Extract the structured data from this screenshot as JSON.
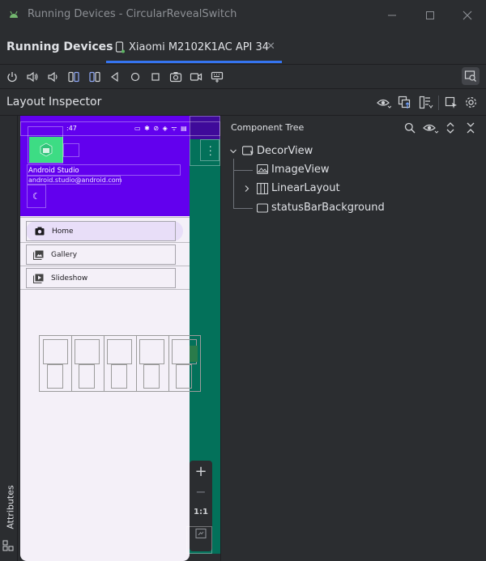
{
  "window": {
    "title": "Running Devices - CircularRevealSwitch",
    "app_icon": "android-icon",
    "controls": [
      "minimize",
      "maximize",
      "close"
    ]
  },
  "tool_window": {
    "title": "Running Devices",
    "device_tab": {
      "label": "Xiaomi M2102K1AC API 34",
      "icon": "phone-icon"
    }
  },
  "toolbar": {
    "icons": [
      "power-icon",
      "volume-up-icon",
      "volume-down-icon",
      "rotate-left-icon",
      "rotate-right-icon",
      "back-icon",
      "home-icon",
      "overview-icon",
      "screenshot-icon",
      "screen-record-icon",
      "settings-device-icon",
      "layout-inspector-toggle-icon"
    ]
  },
  "layout_inspector": {
    "title": "Layout Inspector",
    "header_icons": [
      "eye-icon",
      "snapshot-icon",
      "live-update-icon",
      "select-icon",
      "gear-icon"
    ]
  },
  "side_panel": {
    "label": "Attributes"
  },
  "device_screen": {
    "status_time": ":47",
    "user_name": "Android Studio",
    "user_email": "android.studio@android.com",
    "menu": [
      {
        "label": "Home",
        "icon": "camera-icon",
        "selected": true
      },
      {
        "label": "Gallery",
        "icon": "gallery-icon",
        "selected": false
      },
      {
        "label": "Slideshow",
        "icon": "slideshow-icon",
        "selected": false
      }
    ],
    "colors": {
      "header": "#6200ee",
      "background": "#f4f0f8",
      "selected_item": "#e8def8",
      "content": "#03715a"
    }
  },
  "component_tree": {
    "title": "Component Tree",
    "header_icons": [
      "search-icon",
      "eye-icon",
      "expand-icon",
      "collapse-icon"
    ],
    "nodes": [
      {
        "label": "DecorView",
        "level": 0,
        "expanded": true
      },
      {
        "label": "ImageView",
        "level": 1
      },
      {
        "label": "LinearLayout",
        "level": 1,
        "expanded": false
      },
      {
        "label": "statusBarBackground",
        "level": 1
      }
    ]
  },
  "zoom_controls": {
    "zoom_in": "+",
    "zoom_out": "−",
    "actual_size": "1:1",
    "fit_icon": "fit-screen-icon"
  }
}
